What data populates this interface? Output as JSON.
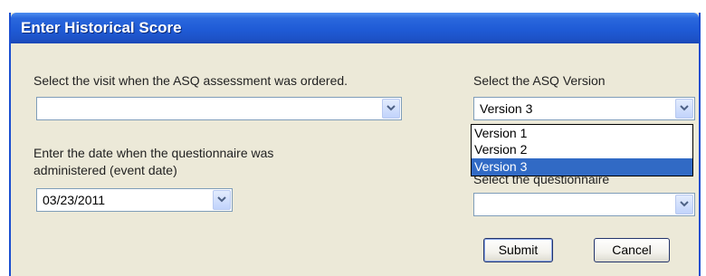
{
  "dialog": {
    "title": "Enter Historical Score"
  },
  "visit": {
    "label": "Select the visit when the ASQ assessment was ordered.",
    "value": ""
  },
  "event_date": {
    "label_line1": "Enter the date when the questionnaire was",
    "label_line2": "administered (event date)",
    "value": "03/23/2011"
  },
  "version": {
    "label": "Select the ASQ Version",
    "value": "Version 3",
    "options": [
      "Version 1",
      "Version 2",
      "Version 3"
    ],
    "selected_option": "Version 3"
  },
  "questionnaire": {
    "label": "Select the questionnaire",
    "value": ""
  },
  "buttons": {
    "submit": "Submit",
    "cancel": "Cancel"
  },
  "colors": {
    "title_bar": "#1f5bd6",
    "dialog_bg": "#ece9d8",
    "selected_item": "#316ac5"
  },
  "icons": {
    "dropdown_arrow": "chevron-down-icon"
  }
}
